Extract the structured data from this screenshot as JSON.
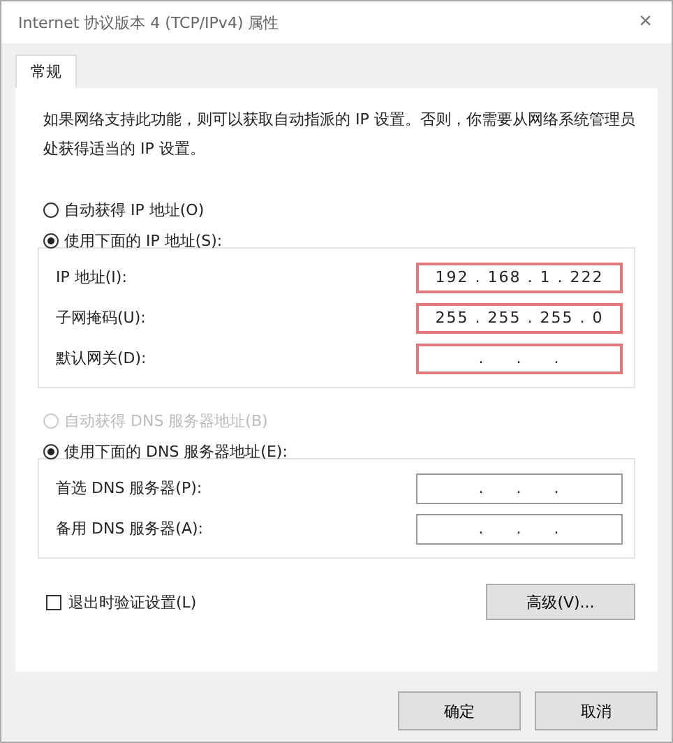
{
  "window": {
    "title": "Internet 协议版本 4 (TCP/IPv4) 属性",
    "close": "×"
  },
  "tabs": [
    {
      "label": "常规",
      "selected": true
    }
  ],
  "intro": "如果网络支持此功能，则可以获取自动指派的 IP 设置。否则，你需要从网络系统管理员处获得适当的 IP 设置。",
  "sections": [
    {
      "auto_option": {
        "label": "自动获得 IP 地址(O)",
        "selected": false,
        "disabled": false
      },
      "manual_option": {
        "label": "使用下面的 IP 地址(S):",
        "selected": true,
        "disabled": false
      },
      "fields": [
        {
          "label": "IP 地址(I):",
          "value": "192 . 168 . 1 . 222",
          "highlighted": true
        },
        {
          "label": "子网掩码(U):",
          "value": "255 . 255 . 255 . 0",
          "highlighted": true
        },
        {
          "label": "默认网关(D):",
          "value": ".     .     .",
          "highlighted": true
        }
      ]
    },
    {
      "auto_option": {
        "label": "自动获得 DNS 服务器地址(B)",
        "selected": false,
        "disabled": true
      },
      "manual_option": {
        "label": "使用下面的 DNS 服务器地址(E):",
        "selected": true,
        "disabled": false
      },
      "fields": [
        {
          "label": "首选 DNS 服务器(P):",
          "value": ".     .     .",
          "highlighted": false
        },
        {
          "label": "备用 DNS 服务器(A):",
          "value": ".     .     .",
          "highlighted": false
        }
      ]
    }
  ],
  "validate": {
    "label": "退出时验证设置(L)",
    "checked": false
  },
  "advanced_button": "高级(V)...",
  "buttons": [
    "确定",
    "取消"
  ]
}
